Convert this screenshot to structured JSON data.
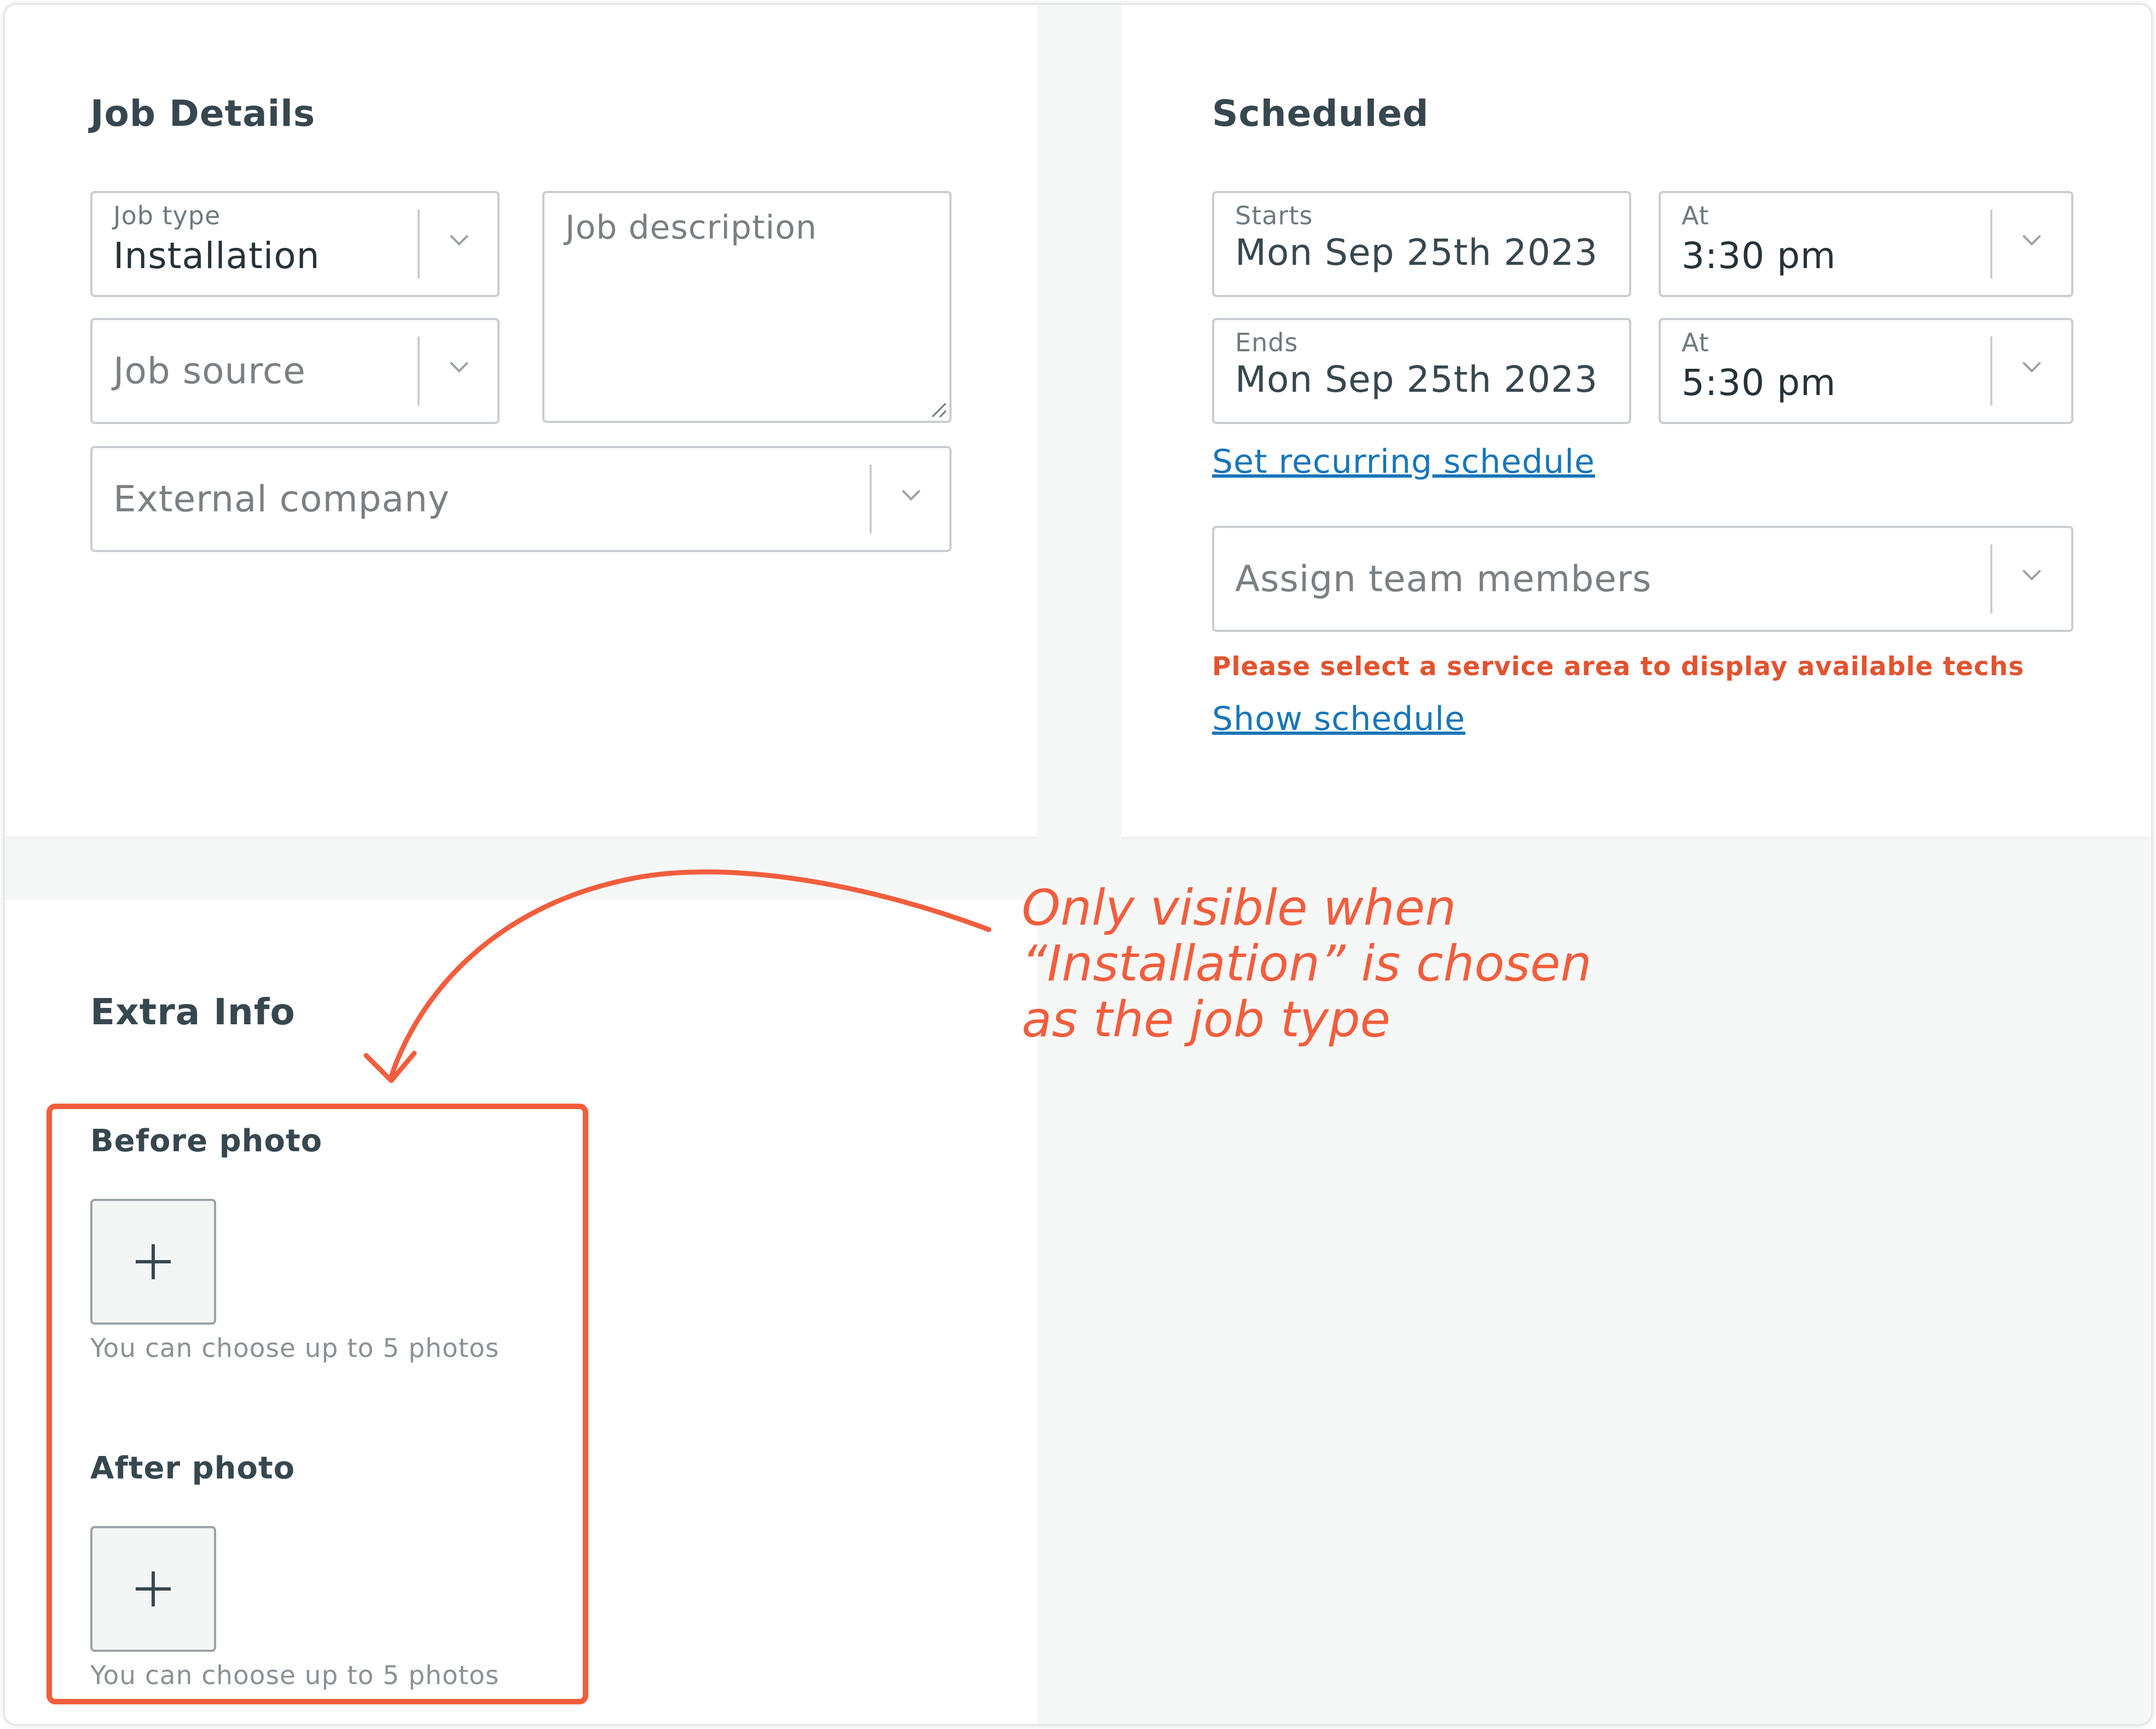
{
  "job_details": {
    "title": "Job Details",
    "job_type": {
      "label": "Job type",
      "value": "Installation"
    },
    "job_source": {
      "placeholder": "Job source"
    },
    "job_description": {
      "placeholder": "Job description"
    },
    "external_company": {
      "placeholder": "External company"
    }
  },
  "scheduled": {
    "title": "Scheduled",
    "starts": {
      "label": "Starts",
      "value": "Mon Sep 25th 2023"
    },
    "starts_at": {
      "label": "At",
      "value": "3:30 pm"
    },
    "ends": {
      "label": "Ends",
      "value": "Mon Sep 25th 2023"
    },
    "ends_at": {
      "label": "At",
      "value": "5:30 pm"
    },
    "recurring_link": "Set recurring schedule",
    "assign_team": {
      "placeholder": "Assign team members"
    },
    "error_message": "Please select a service area to display available techs",
    "show_schedule_link": "Show schedule"
  },
  "extra_info": {
    "title": "Extra Info",
    "before_photo": {
      "label": "Before photo",
      "hint": "You can choose up to 5 photos"
    },
    "after_photo": {
      "label": "After photo",
      "hint": "You can choose up to 5 photos"
    }
  },
  "annotation": {
    "lines": [
      "Only visible when",
      "“Installation” is chosen",
      "as the job type"
    ]
  },
  "colors": {
    "accent": "#f25e3d",
    "link": "#1976b8",
    "error": "#e2532f"
  },
  "icons": {
    "dropdown": "chevron-down-icon",
    "add": "plus-icon",
    "resize": "resize-handle-icon",
    "annotation_arrow": "curved-arrow-icon"
  }
}
